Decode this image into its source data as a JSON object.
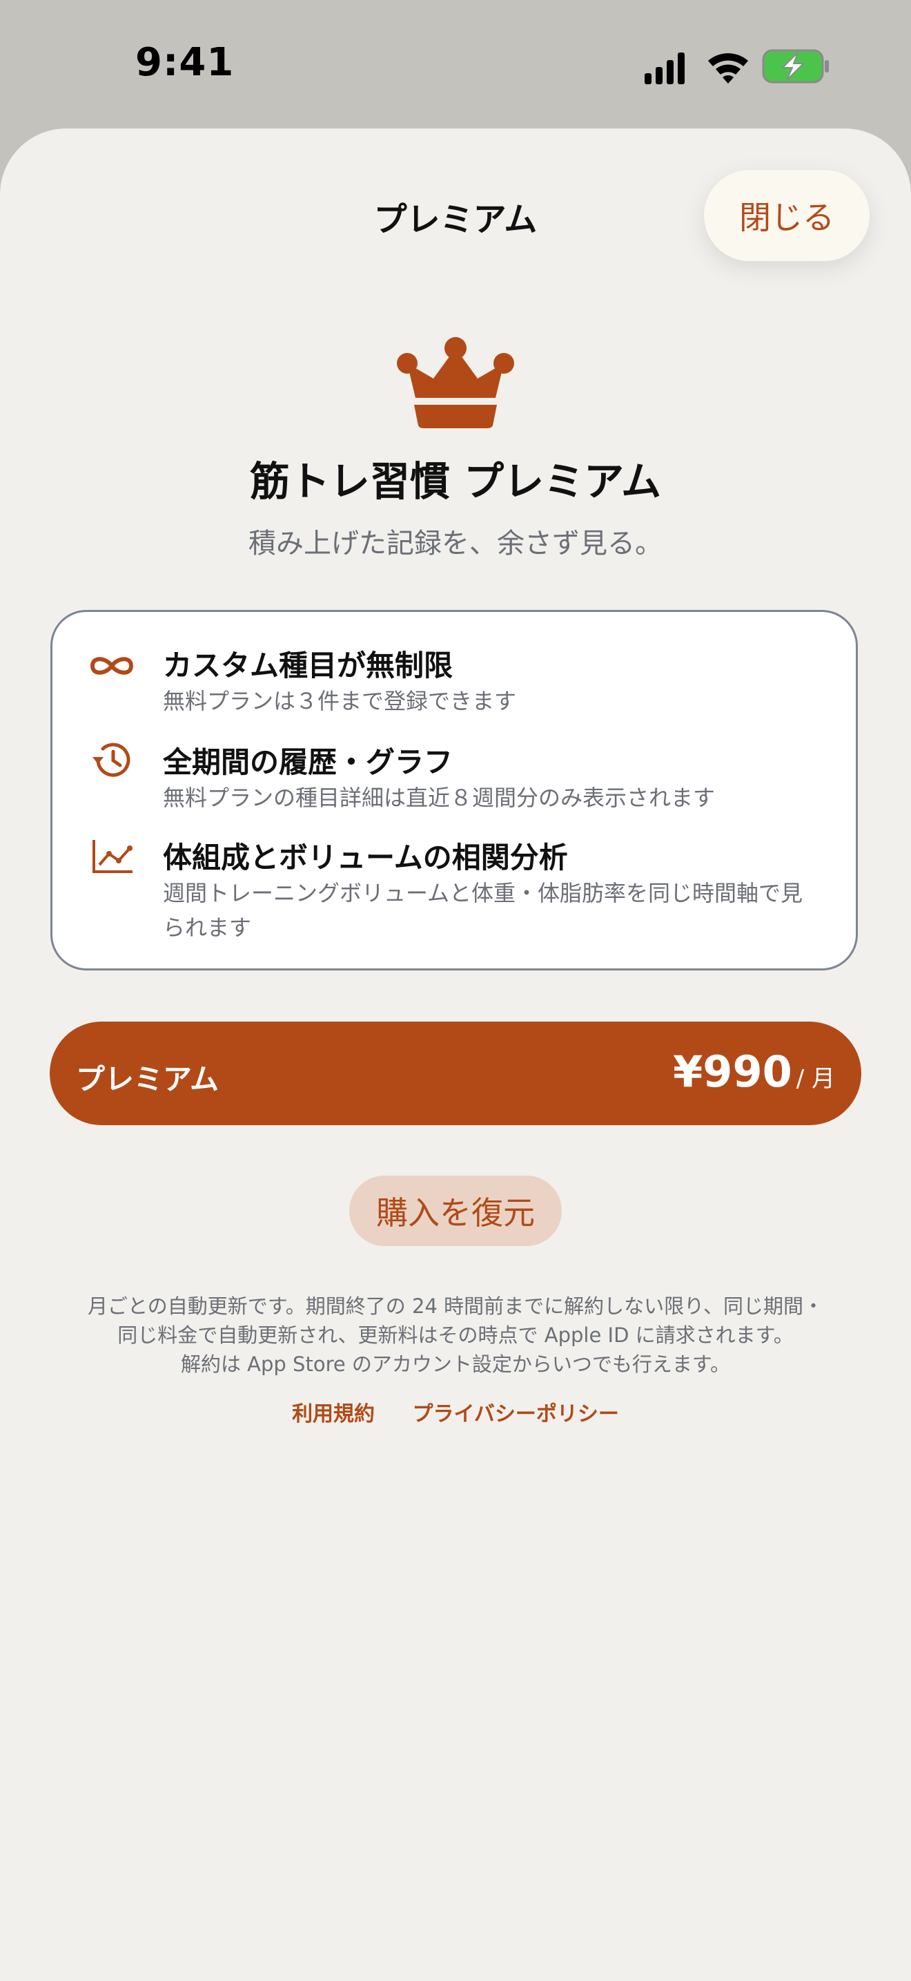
{
  "status_bar": {
    "time": "9:41",
    "icons": [
      "signal-icon",
      "wifi-icon",
      "battery-charging-icon"
    ]
  },
  "nav": {
    "title": "プレミアム",
    "close_label": "閉じる"
  },
  "hero": {
    "icon": "crown-icon",
    "title": "筋トレ習慣 プレミアム",
    "subtitle": "積み上げた記録を、余さず見る。"
  },
  "features": [
    {
      "icon": "infinity-icon",
      "title": "カスタム種目が無制限",
      "desc": "無料プランは３件まで登録できます"
    },
    {
      "icon": "history-icon",
      "title": "全期間の履歴・グラフ",
      "desc": "無料プランの種目詳細は直近８週間分のみ表示されます"
    },
    {
      "icon": "chart-line-icon",
      "title": "体組成とボリュームの相関分析",
      "desc": "週間トレーニングボリュームと体重・体脂肪率を同じ時間軸で見られます"
    }
  ],
  "plan": {
    "name": "プレミアム",
    "price": "¥990",
    "period": "/ 月"
  },
  "restore_label": "購入を復元",
  "legal": {
    "line1": "月ごとの自動更新です。期間終了の 24 時間前までに解約しない限り、同じ期間・",
    "line2": "同じ料金で自動更新され、更新料はその時点で Apple ID に請求されます。",
    "line3": "解約は App Store のアカウント設定からいつでも行えます。",
    "terms_label": "利用規約",
    "privacy_label": "プライバシーポリシー"
  },
  "colors": {
    "accent": "#b24a18",
    "sheet_background": "#f1f0ec",
    "secondary_text": "#6c6f76",
    "restore_background": "#ead3c4",
    "battery_green": "#4cc44c"
  }
}
